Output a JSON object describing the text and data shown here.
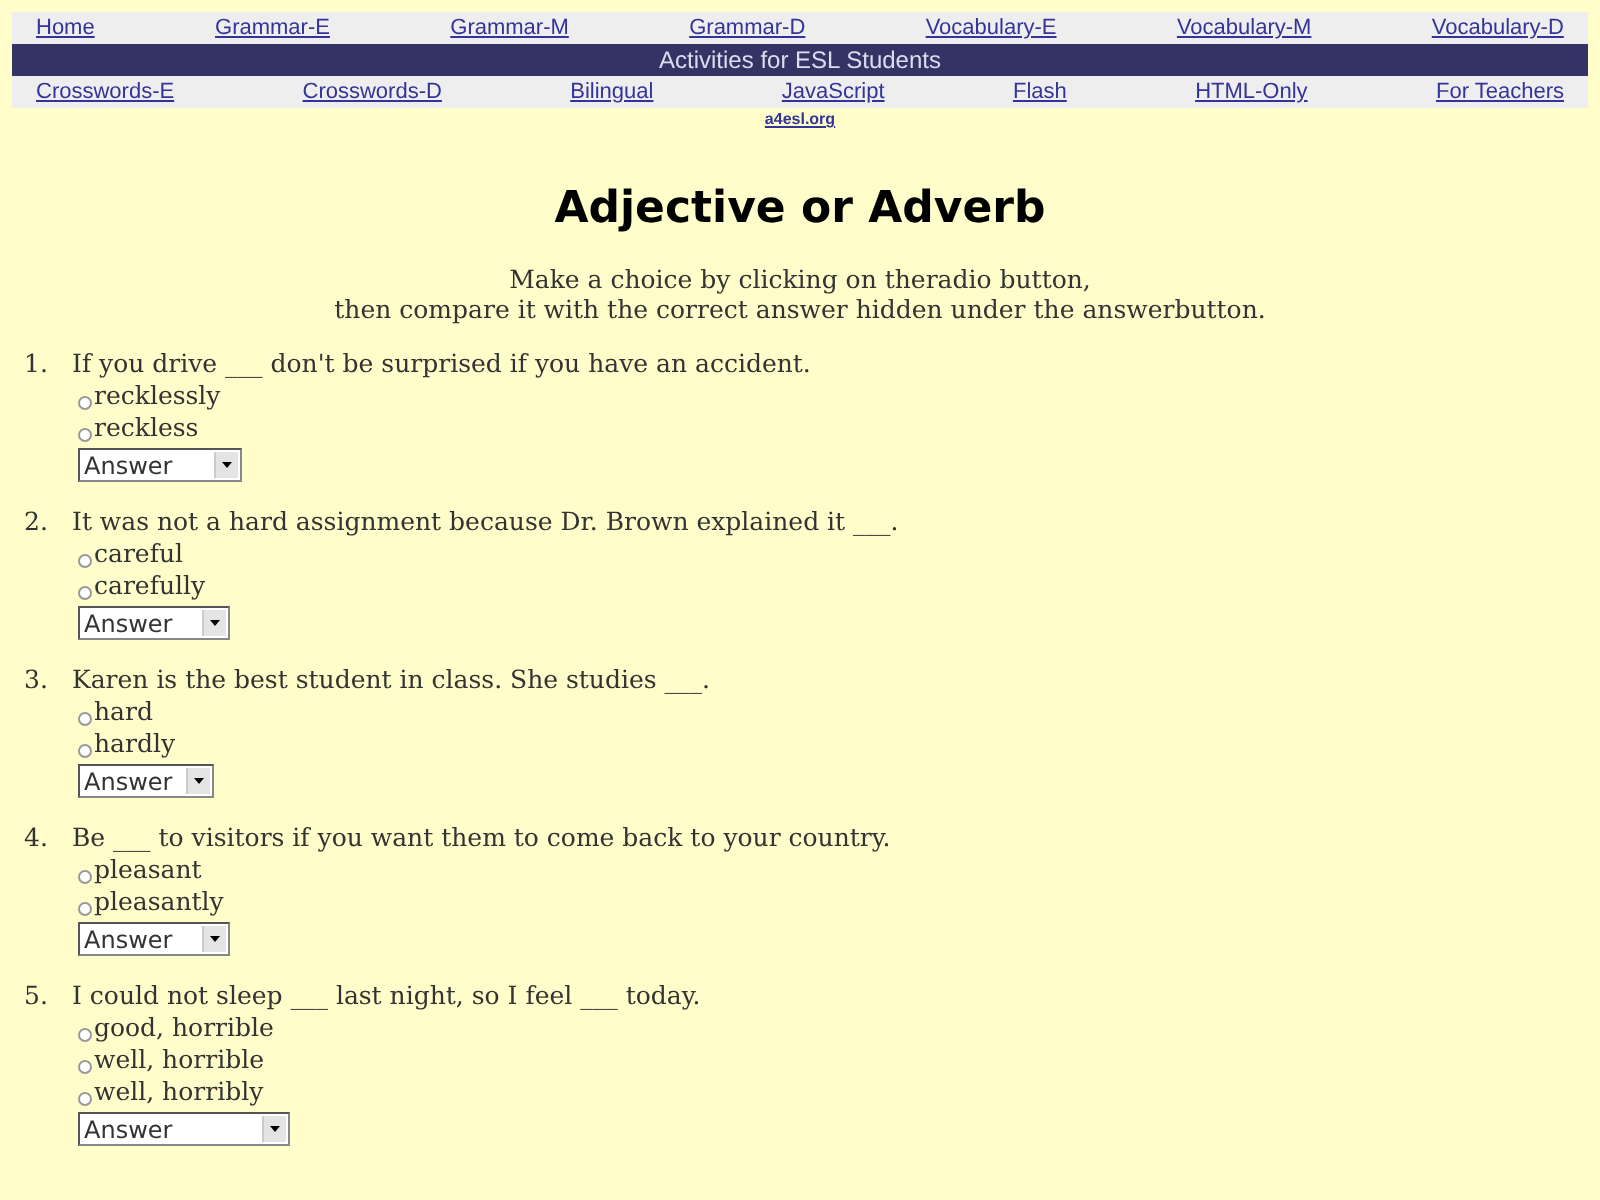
{
  "nav_top": [
    "Home",
    "Grammar-E",
    "Grammar-M",
    "Grammar-D",
    "Vocabulary-E",
    "Vocabulary-M",
    "Vocabulary-D"
  ],
  "banner": "Activities for ESL Students",
  "nav_bottom": [
    "Crosswords-E",
    "Crosswords-D",
    "Bilingual",
    "JavaScript",
    "Flash",
    "HTML-Only",
    "For Teachers"
  ],
  "site_link": "a4esl.org",
  "title": "Adjective or Adverb",
  "instructions": [
    "Make a choice by clicking on theradio button,",
    "then compare it with the correct answer hidden under the answerbutton."
  ],
  "questions": [
    {
      "number": "1.",
      "text": "If you drive ___ don't be surprised if you have an accident.",
      "options": [
        {
          "label": "recklessly",
          "selected": false
        },
        {
          "label": "reckless",
          "selected": false
        }
      ],
      "answer": "Answer"
    },
    {
      "number": "2.",
      "text": "It was not a hard assignment because Dr. Brown explained it ___.",
      "options": [
        {
          "label": "careful",
          "selected": false
        },
        {
          "label": "carefully",
          "selected": false
        }
      ],
      "answer": "Answer"
    },
    {
      "number": "3.",
      "text": "Karen is the best student in class. She studies ___.",
      "options": [
        {
          "label": "hard",
          "selected": false
        },
        {
          "label": "hardly",
          "selected": false
        }
      ],
      "answer": "Answer"
    },
    {
      "number": "4.",
      "text": "Be ___ to visitors if you want them to come back to your country.",
      "options": [
        {
          "label": "pleasant",
          "selected": false
        },
        {
          "label": "pleasantly",
          "selected": false
        }
      ],
      "answer": "Answer"
    },
    {
      "number": "5.",
      "text": "I could not sleep ___ last night, so I feel ___ today.",
      "options": [
        {
          "label": "good, horrible",
          "selected": false
        },
        {
          "label": "well, horrible",
          "selected": false
        },
        {
          "label": "well, horribly",
          "selected": false
        }
      ],
      "answer": "Answer"
    }
  ]
}
